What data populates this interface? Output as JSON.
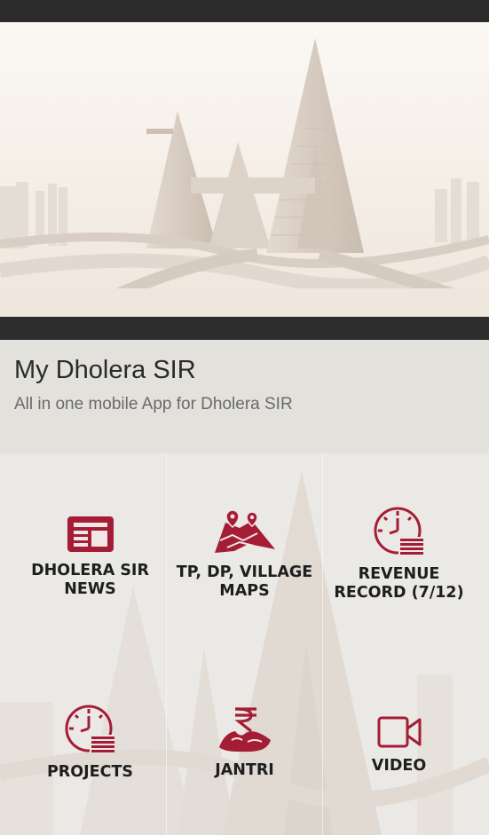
{
  "app": {
    "title": "My Dholera SIR",
    "subtitle": "All in one mobile App for Dholera SIR"
  },
  "colors": {
    "accent": "#a51c35",
    "topbar": "#2b2b2b",
    "header_bg": "#e3e1dc"
  },
  "tiles": [
    {
      "label": "DHOLERA SIR\nNEWS",
      "icon": "newspaper-icon"
    },
    {
      "label": "TP, DP, VILLAGE\nMAPS",
      "icon": "map-pins-icon"
    },
    {
      "label": "REVENUE\nRECORD (7/12)",
      "icon": "clock-document-icon"
    },
    {
      "label": "PROJECTS",
      "icon": "clock-document-icon"
    },
    {
      "label": "JANTRI",
      "icon": "rupee-land-icon"
    },
    {
      "label": "VIDEO",
      "icon": "video-camera-icon"
    }
  ]
}
